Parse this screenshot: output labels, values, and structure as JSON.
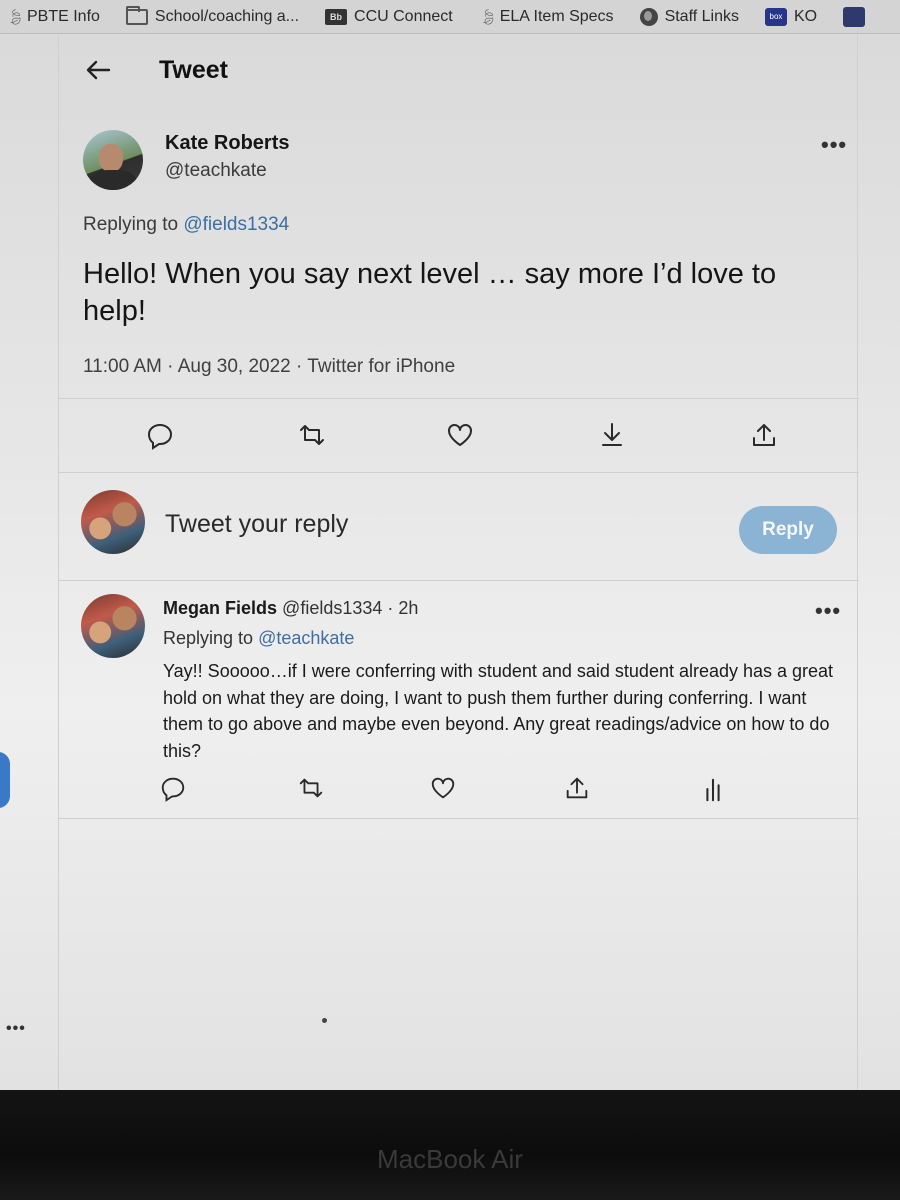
{
  "bookmarks": [
    {
      "label": "PBTE Info",
      "icon": "leaf-icon"
    },
    {
      "label": "School/coaching a...",
      "icon": "folder-icon"
    },
    {
      "label": "CCU Connect",
      "icon": "blackboard-icon"
    },
    {
      "label": "ELA Item Specs",
      "icon": "leaf-icon"
    },
    {
      "label": "Staff Links",
      "icon": "globe-icon"
    },
    {
      "label": "KO",
      "icon": "box-icon"
    }
  ],
  "header": {
    "title": "Tweet"
  },
  "tweet": {
    "author_name": "Kate Roberts",
    "author_handle": "@teachkate",
    "replying_prefix": "Replying to",
    "replying_to": "@fields1334",
    "text": "Hello! When you say next level … say more I’d love to help!",
    "meta": "11:00 AM · Aug 30, 2022 · Twitter for iPhone"
  },
  "composer": {
    "placeholder": "Tweet your reply",
    "button_label": "Reply"
  },
  "reply": {
    "author_name": "Megan Fields",
    "author_handle": "@fields1334",
    "time": "· 2h",
    "replying_prefix": "Replying to",
    "replying_to": "@teachkate",
    "text": "Yay!! Sooooo…if I were conferring with student and said student already has a great hold on what they are doing, I want to push them further during conferring. I want them to go above and maybe even beyond. Any great readings/advice on how to do this?"
  },
  "more_glyph": "•••",
  "side_dots": "•••",
  "device_label": "MacBook Air",
  "colors": {
    "link": "#3d6fa3",
    "reply_button": "#8bb3d3"
  }
}
